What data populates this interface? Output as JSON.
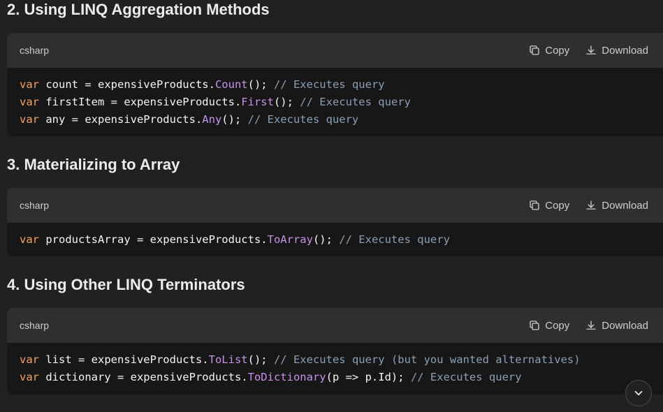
{
  "sections": [
    {
      "heading": "2. Using LINQ Aggregation Methods",
      "language": "csharp",
      "copy_label": "Copy",
      "download_label": "Download",
      "lines": [
        {
          "kw": "var",
          "pre": " count = expensiveProducts.",
          "fn": "Count",
          "post": "(); ",
          "comment": "// Executes query"
        },
        {
          "kw": "var",
          "pre": " firstItem = expensiveProducts.",
          "fn": "First",
          "post": "(); ",
          "comment": "// Executes query"
        },
        {
          "kw": "var",
          "pre": " any = expensiveProducts.",
          "fn": "Any",
          "post": "(); ",
          "comment": "// Executes query"
        }
      ]
    },
    {
      "heading": "3. Materializing to Array",
      "language": "csharp",
      "copy_label": "Copy",
      "download_label": "Download",
      "lines": [
        {
          "kw": "var",
          "pre": " productsArray = expensiveProducts.",
          "fn": "ToArray",
          "post": "(); ",
          "comment": "// Executes query"
        }
      ]
    },
    {
      "heading": "4. Using Other LINQ Terminators",
      "language": "csharp",
      "copy_label": "Copy",
      "download_label": "Download",
      "lines": [
        {
          "kw": "var",
          "pre": " list = expensiveProducts.",
          "fn": "ToList",
          "post": "(); ",
          "comment": "// Executes query (but you wanted alternatives)"
        },
        {
          "kw": "var",
          "pre": " dictionary = expensiveProducts.",
          "fn": "ToDictionary",
          "post": "(p => p.Id); ",
          "comment": "// Executes query"
        }
      ]
    }
  ],
  "icons": {
    "copy": "copy-icon",
    "download": "download-icon",
    "scroll": "chevron-down-icon"
  }
}
